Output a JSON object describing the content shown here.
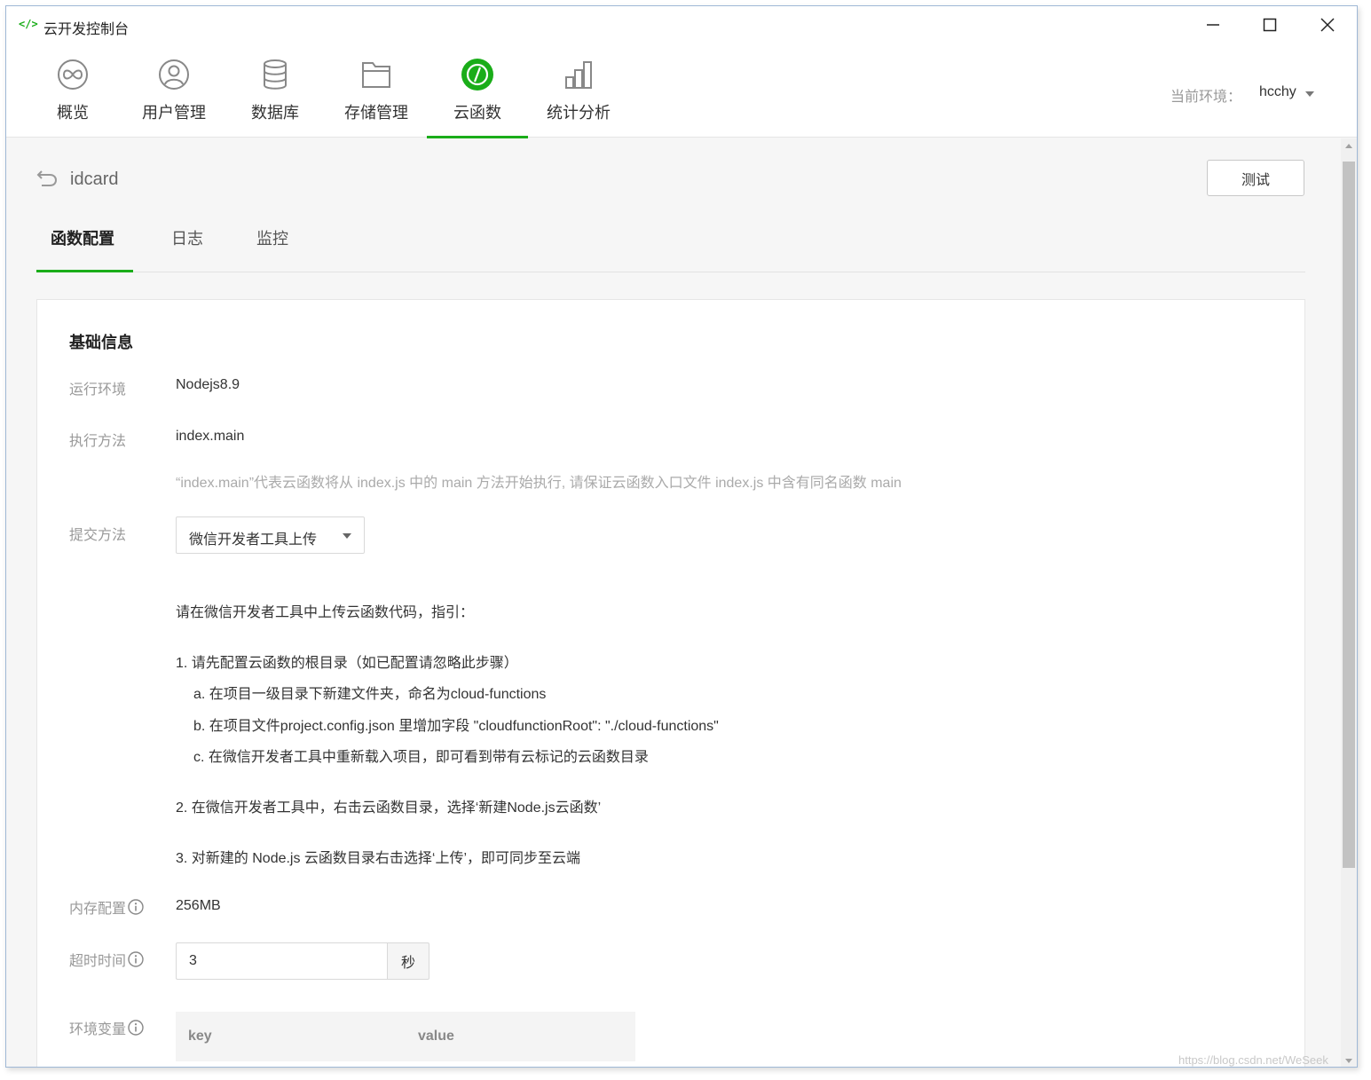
{
  "window": {
    "app_icon": "</>",
    "title": "云开发控制台"
  },
  "topnav": {
    "items": [
      {
        "label": "概览",
        "icon": "infinity-icon"
      },
      {
        "label": "用户管理",
        "icon": "user-icon"
      },
      {
        "label": "数据库",
        "icon": "database-icon"
      },
      {
        "label": "存储管理",
        "icon": "folder-icon"
      },
      {
        "label": "云函数",
        "icon": "cloud-function-icon",
        "active": true
      },
      {
        "label": "统计分析",
        "icon": "chart-icon"
      }
    ],
    "env_label": "当前环境：",
    "env_value": "hcchy"
  },
  "header": {
    "title": "idcard",
    "test_button": "测试"
  },
  "tabs": [
    {
      "label": "函数配置",
      "active": true
    },
    {
      "label": "日志"
    },
    {
      "label": "监控"
    }
  ],
  "basic": {
    "section_title": "基础信息",
    "runtime_label": "运行环境",
    "runtime_value": "Nodejs8.9",
    "handler_label": "执行方法",
    "handler_value": "index.main",
    "handler_hint": "“index.main”代表云函数将从 index.js 中的 main 方法开始执行, 请保证云函数入口文件 index.js 中含有同名函数 main",
    "submit_label": "提交方法",
    "submit_value": "微信开发者工具上传",
    "guide": {
      "intro": "请在微信开发者工具中上传云函数代码，指引：",
      "step1": "1. 请先配置云函数的根目录（如已配置请忽略此步骤）",
      "step1a": "a. 在项目一级目录下新建文件夹，命名为cloud-functions",
      "step1b": "b. 在项目文件project.config.json 里增加字段 \"cloudfunctionRoot\": \"./cloud-functions\"",
      "step1c": "c. 在微信开发者工具中重新载入项目，即可看到带有云标记的云函数目录",
      "step2": "2. 在微信开发者工具中，右击云函数目录，选择‘新建Node.js云函数’",
      "step3": "3. 对新建的 Node.js 云函数目录右击选择‘上传’，即可同步至云端"
    },
    "memory_label": "内存配置",
    "memory_value": "256MB",
    "timeout_label": "超时时间",
    "timeout_value": "3",
    "timeout_unit": "秒",
    "envvar_label": "环境变量",
    "envvar_key_header": "key",
    "envvar_value_header": "value"
  },
  "watermark": "https://blog.csdn.net/WeSeek",
  "colors": {
    "accent": "#1aad19"
  }
}
